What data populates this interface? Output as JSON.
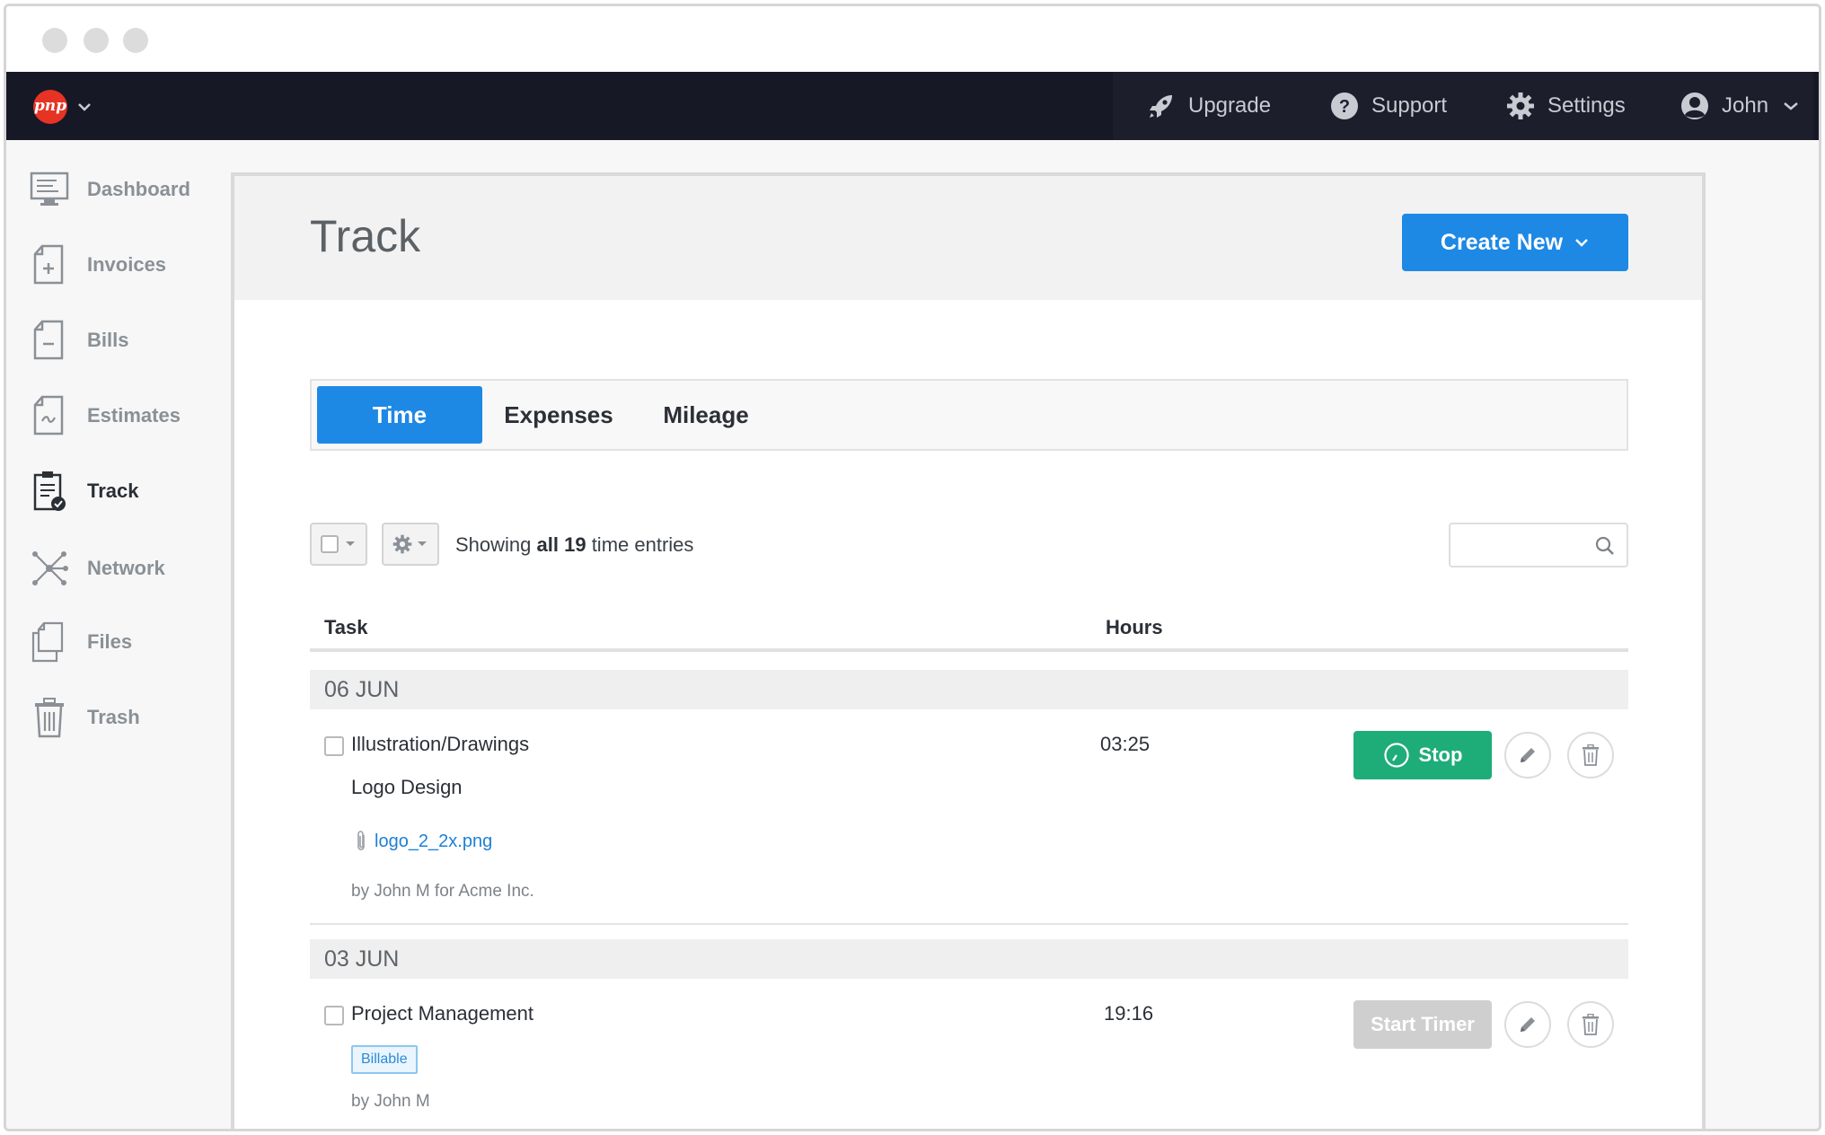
{
  "window": {
    "controls": [
      "close",
      "minimize",
      "maximize"
    ]
  },
  "navbar": {
    "logo_text": "pnp",
    "items": [
      {
        "label": "Upgrade",
        "icon": "rocket-icon"
      },
      {
        "label": "Support",
        "icon": "question-icon"
      },
      {
        "label": "Settings",
        "icon": "gear-icon"
      },
      {
        "label": "John",
        "icon": "user-icon"
      }
    ]
  },
  "sidebar": {
    "items": [
      {
        "label": "Dashboard",
        "icon": "monitor-icon"
      },
      {
        "label": "Invoices",
        "icon": "invoice-icon"
      },
      {
        "label": "Bills",
        "icon": "bill-icon"
      },
      {
        "label": "Estimates",
        "icon": "estimate-icon"
      },
      {
        "label": "Track",
        "icon": "clipboard-check-icon",
        "active": true
      },
      {
        "label": "Network",
        "icon": "network-icon"
      },
      {
        "label": "Files",
        "icon": "files-icon"
      },
      {
        "label": "Trash",
        "icon": "trash-icon"
      }
    ]
  },
  "page": {
    "title": "Track",
    "create_button": "Create New"
  },
  "tabs": [
    {
      "label": "Time",
      "active": true
    },
    {
      "label": "Expenses",
      "active": false
    },
    {
      "label": "Mileage",
      "active": false
    }
  ],
  "toolbar": {
    "showing_prefix": "Showing",
    "showing_all": "all 19",
    "showing_suffix": "time entries",
    "search_placeholder": ""
  },
  "table": {
    "headers": {
      "task": "Task",
      "hours": "Hours"
    },
    "groups": [
      {
        "date": "06 JUN",
        "entry": {
          "task": "Illustration/Drawings",
          "hours": "03:25",
          "description": "Logo Design",
          "attachment": "logo_2_2x.png",
          "byline": "by John M for Acme Inc.",
          "action": "Stop"
        }
      },
      {
        "date": "03 JUN",
        "entry": {
          "task": "Project Management",
          "hours": "19:16",
          "badge": "Billable",
          "byline": "by John M",
          "action": "Start Timer"
        }
      }
    ]
  },
  "colors": {
    "navbar": "#161826",
    "primary": "#1e88e5",
    "stop": "#1ead78",
    "logo": "#e63323"
  }
}
